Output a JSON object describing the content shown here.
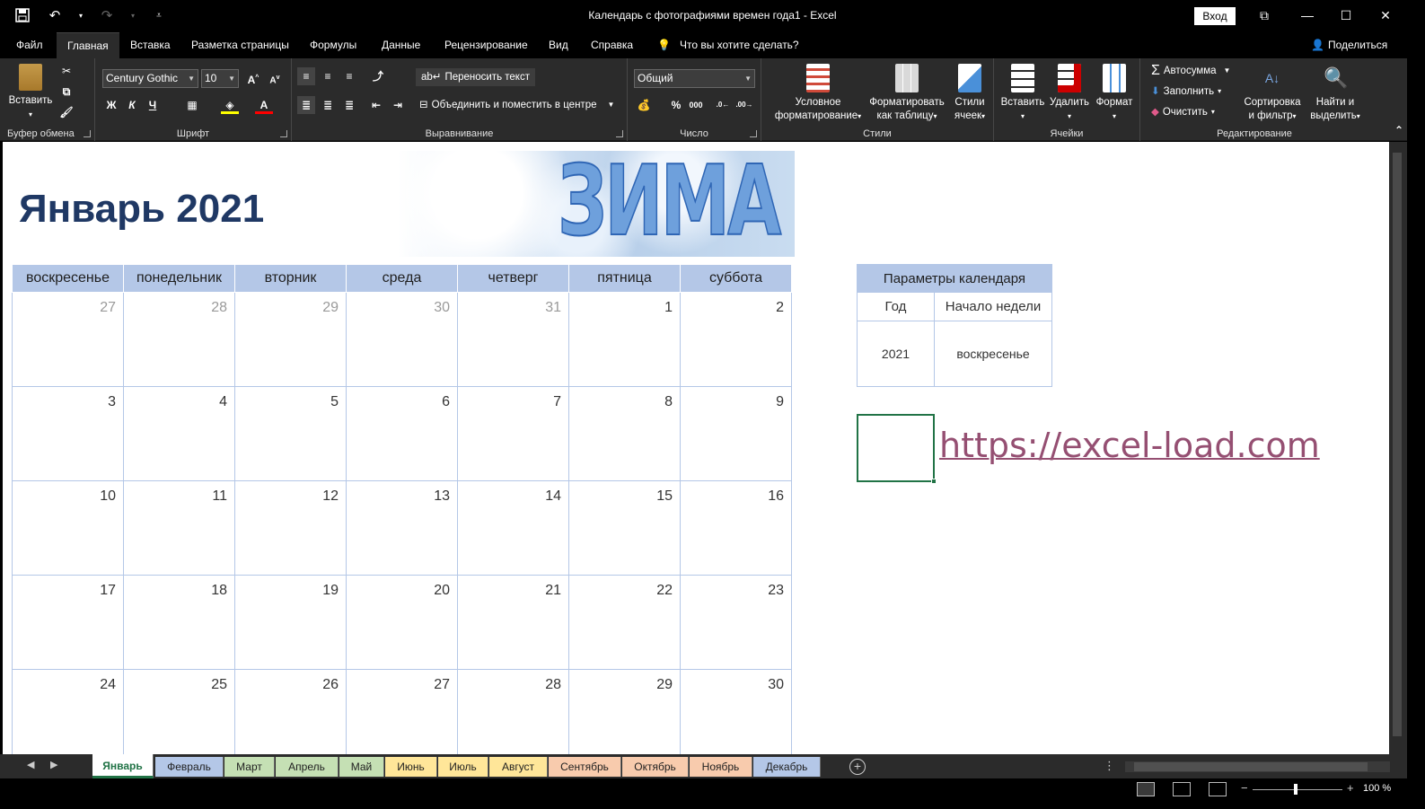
{
  "window": {
    "title": "Календарь с фотографиями времен года1  -  Excel",
    "signin_label": "Вход"
  },
  "ribbon_tabs": [
    {
      "label": "Файл",
      "active": false
    },
    {
      "label": "Главная",
      "active": true
    },
    {
      "label": "Вставка",
      "active": false
    },
    {
      "label": "Разметка страницы",
      "active": false
    },
    {
      "label": "Формулы",
      "active": false
    },
    {
      "label": "Данные",
      "active": false
    },
    {
      "label": "Рецензирование",
      "active": false
    },
    {
      "label": "Вид",
      "active": false
    },
    {
      "label": "Справка",
      "active": false
    }
  ],
  "tell_me": "Что вы хотите сделать?",
  "share": "Поделиться",
  "ribbon": {
    "clipboard": {
      "paste": "Вставить",
      "label": "Буфер обмена"
    },
    "font": {
      "name": "Century Gothic",
      "size": "10",
      "bold": "Ж",
      "italic": "К",
      "underline": "Ч",
      "label": "Шрифт"
    },
    "alignment": {
      "wrap": "Переносить текст",
      "merge": "Объединить и поместить в центре",
      "label": "Выравнивание"
    },
    "number": {
      "format": "Общий",
      "label": "Число"
    },
    "styles": {
      "conditional_1": "Условное",
      "conditional_2": "форматирование",
      "table_1": "Форматировать",
      "table_2": "как таблицу",
      "cell_1": "Стили",
      "cell_2": "ячеек",
      "label": "Стили"
    },
    "cells": {
      "insert": "Вставить",
      "delete": "Удалить",
      "format": "Формат",
      "label": "Ячейки"
    },
    "editing": {
      "autosum": "Автосумма",
      "fill": "Заполнить",
      "clear": "Очистить",
      "sort_1": "Сортировка",
      "sort_2": "и фильтр",
      "find_1": "Найти и",
      "find_2": "выделить",
      "label": "Редактирование"
    }
  },
  "sheet": {
    "month_title": "Январь 2021",
    "banner_word": "ЗИМА",
    "weekdays": [
      "воскресенье",
      "понедельник",
      "вторник",
      "среда",
      "четверг",
      "пятница",
      "суббота"
    ],
    "weeks": [
      [
        {
          "d": "27",
          "other": true
        },
        {
          "d": "28",
          "other": true
        },
        {
          "d": "29",
          "other": true
        },
        {
          "d": "30",
          "other": true
        },
        {
          "d": "31",
          "other": true
        },
        {
          "d": "1",
          "other": false
        },
        {
          "d": "2",
          "other": false
        }
      ],
      [
        {
          "d": "3"
        },
        {
          "d": "4"
        },
        {
          "d": "5"
        },
        {
          "d": "6"
        },
        {
          "d": "7"
        },
        {
          "d": "8"
        },
        {
          "d": "9"
        }
      ],
      [
        {
          "d": "10"
        },
        {
          "d": "11"
        },
        {
          "d": "12"
        },
        {
          "d": "13"
        },
        {
          "d": "14"
        },
        {
          "d": "15"
        },
        {
          "d": "16"
        }
      ],
      [
        {
          "d": "17"
        },
        {
          "d": "18"
        },
        {
          "d": "19"
        },
        {
          "d": "20"
        },
        {
          "d": "21"
        },
        {
          "d": "22"
        },
        {
          "d": "23"
        }
      ],
      [
        {
          "d": "24"
        },
        {
          "d": "25"
        },
        {
          "d": "26"
        },
        {
          "d": "27"
        },
        {
          "d": "28"
        },
        {
          "d": "29"
        },
        {
          "d": "30"
        }
      ]
    ],
    "params": {
      "title": "Параметры календаря",
      "year_label": "Год",
      "week_start_label": "Начало недели",
      "year": "2021",
      "week_start": "воскресенье"
    },
    "link": "https://excel-load.com"
  },
  "sheet_tabs": [
    {
      "label": "Январь",
      "color": "#ffffff",
      "active": true
    },
    {
      "label": "Февраль",
      "color": "#b4c7e7",
      "active": false
    },
    {
      "label": "Март",
      "color": "#c5e0b4",
      "active": false
    },
    {
      "label": "Апрель",
      "color": "#c5e0b4",
      "active": false
    },
    {
      "label": "Май",
      "color": "#c5e0b4",
      "active": false
    },
    {
      "label": "Июнь",
      "color": "#ffe699",
      "active": false
    },
    {
      "label": "Июль",
      "color": "#ffe699",
      "active": false
    },
    {
      "label": "Август",
      "color": "#ffe699",
      "active": false
    },
    {
      "label": "Сентябрь",
      "color": "#f8cbad",
      "active": false
    },
    {
      "label": "Октябрь",
      "color": "#f8cbad",
      "active": false
    },
    {
      "label": "Ноябрь",
      "color": "#f8cbad",
      "active": false
    },
    {
      "label": "Декабрь",
      "color": "#b4c7e7",
      "active": false
    }
  ],
  "status": {
    "zoom": "100 %"
  },
  "colors": {
    "accent": "#217346",
    "header_fill": "#b4c7e7",
    "title": "#1f3864",
    "link": "#954f72"
  }
}
